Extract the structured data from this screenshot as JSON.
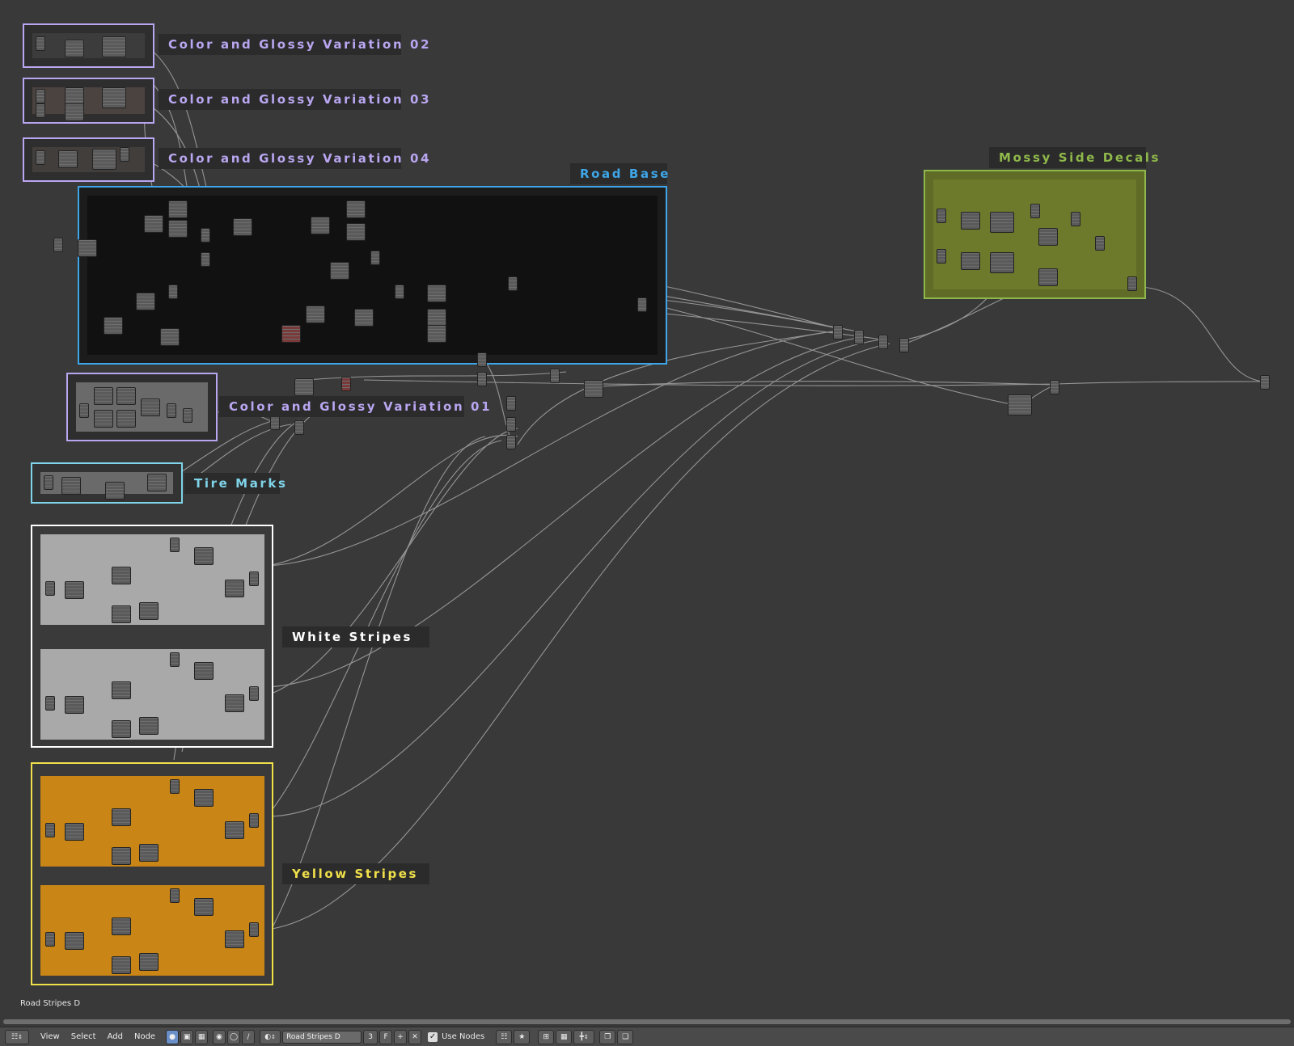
{
  "material_name_footer": "Road Stripes D",
  "header": {
    "editor_type_icon": "node-editor-icon",
    "menus": [
      "View",
      "Select",
      "Add",
      "Node"
    ],
    "shader_type_icons": [
      "object-shader-icon",
      "world-shader-icon",
      "texture-shader-icon"
    ],
    "shader_sources": [
      "object-icon",
      "world-icon",
      "line-style-icon"
    ],
    "material_browse_icon": "material-sphere-icon",
    "material_name": "Road Stripes D",
    "user_count": "3",
    "fake_user": "F",
    "use_nodes_label": "Use Nodes",
    "use_nodes_checked": true
  },
  "frames": {
    "cg02": {
      "label": "Color and Glossy Variation 02",
      "color": "#b9a6f0"
    },
    "cg03": {
      "label": "Color and Glossy Variation 03",
      "color": "#b9a6f0"
    },
    "cg04": {
      "label": "Color and Glossy Variation 04",
      "color": "#b9a6f0"
    },
    "road_base": {
      "label": "Road Base",
      "color": "#3ea6e8"
    },
    "mossy": {
      "label": "Mossy Side Decals",
      "color": "#8fb84a"
    },
    "cg01": {
      "label": "Color and Glossy Variation 01",
      "color": "#b9a6f0"
    },
    "tire": {
      "label": "Tire Marks",
      "color": "#7fd4ea"
    },
    "white": {
      "label": "White Stripes",
      "color": "#ffffff"
    },
    "yellow": {
      "label": "Yellow Stripes",
      "color": "#f0e04a"
    }
  }
}
